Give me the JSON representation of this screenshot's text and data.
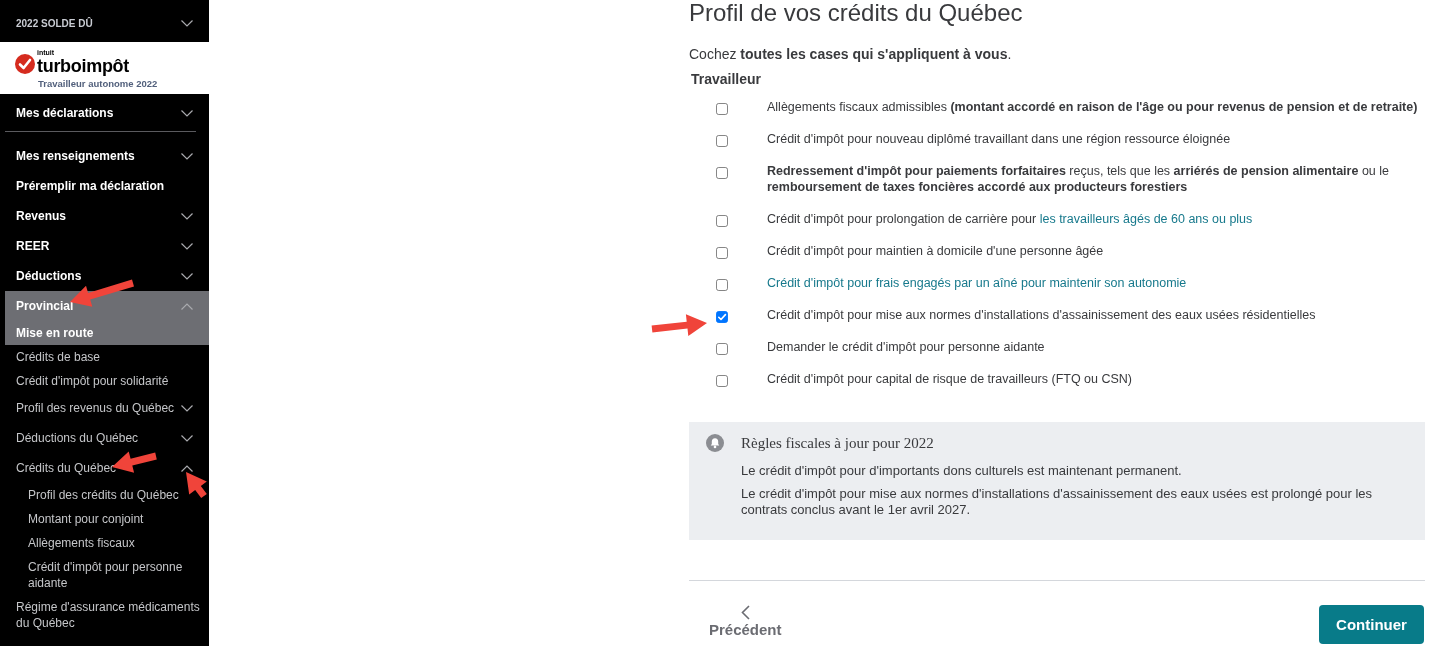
{
  "sidebar": {
    "balance": {
      "label": "2022 SOLDE DÛ",
      "expanded": false
    },
    "logo": {
      "brand": "intuit",
      "product": "turboimpôt",
      "edition": "Travailleur autonome 2022"
    },
    "menu_groups": [
      {
        "items": [
          {
            "label": "Mes déclarations",
            "kind": "group",
            "expanded": false,
            "selected": false
          }
        ]
      },
      {
        "items": [
          {
            "label": "Mes renseignements",
            "kind": "group",
            "expanded": false,
            "selected": false
          },
          {
            "label": "Préremplir ma déclaration",
            "kind": "link",
            "selected": false
          },
          {
            "label": "Revenus",
            "kind": "group",
            "expanded": false,
            "selected": false
          },
          {
            "label": "REER",
            "kind": "group",
            "expanded": false,
            "selected": false
          },
          {
            "label": "Déductions",
            "kind": "group",
            "expanded": false,
            "selected": false
          },
          {
            "label": "Provincial",
            "kind": "group",
            "expanded": true,
            "selected": true,
            "children": [
              {
                "label": "Mise en route",
                "kind": "link",
                "selected": true
              },
              {
                "label": "Crédits de base",
                "kind": "link",
                "selected": false
              },
              {
                "label": "Crédit d'impôt pour solidarité",
                "kind": "link",
                "selected": false
              },
              {
                "label": "Profil des revenus du Québec",
                "kind": "group",
                "expanded": false,
                "selected": false
              },
              {
                "label": "Déductions du Québec",
                "kind": "group",
                "expanded": false,
                "selected": false
              },
              {
                "label": "Crédits du Québec",
                "kind": "group",
                "expanded": true,
                "selected": false,
                "children": [
                  {
                    "label": "Profil des crédits du Québec",
                    "kind": "link",
                    "selected": false
                  },
                  {
                    "label": "Montant pour conjoint",
                    "kind": "link",
                    "selected": false
                  },
                  {
                    "label": "Allègements fiscaux",
                    "kind": "link",
                    "selected": false
                  },
                  {
                    "label": "Crédit d'impôt pour personne aidante",
                    "kind": "link",
                    "selected": false
                  }
                ]
              },
              {
                "label": "Régime d'assurance médicaments du Québec",
                "kind": "link",
                "selected": false
              }
            ]
          }
        ]
      }
    ]
  },
  "main": {
    "title": "Profil de vos crédits du Québec",
    "instruction": "Cochez **toutes les cases qui s'appliquent à vous**.",
    "section_label": "Travailleur",
    "options": [
      {
        "parts": [
          {
            "kind": "text",
            "text": "Allègements fiscaux admissibles **(montant accordé en raison de l'âge ou pour revenus de pension et de retraite)**"
          }
        ],
        "checked": false
      },
      {
        "parts": [
          {
            "kind": "text",
            "text": "Crédit d'impôt pour nouveau diplômé travaillant dans une région ressource éloignée"
          }
        ],
        "checked": false
      },
      {
        "parts": [
          {
            "kind": "text",
            "text": "**Redressement d'impôt pour paiements forfaitaires** reçus, tels que les **arriérés de pension alimentaire** ou le **remboursement de taxes foncières accordé aux producteurs forestiers**"
          }
        ],
        "checked": false
      },
      {
        "parts": [
          {
            "kind": "text",
            "text": "Crédit d'impôt pour prolongation de carrière pour "
          },
          {
            "kind": "link",
            "text": "les travailleurs âgés de 60 ans ou plus"
          }
        ],
        "checked": false
      },
      {
        "parts": [
          {
            "kind": "text",
            "text": "Crédit d'impôt pour maintien à domicile d'une personne âgée"
          }
        ],
        "checked": false
      },
      {
        "parts": [
          {
            "kind": "link",
            "text": "Crédit d'impôt pour frais engagés par un aîné pour maintenir son autonomie"
          }
        ],
        "checked": false
      },
      {
        "parts": [
          {
            "kind": "text",
            "text": "Crédit d'impôt pour mise aux normes d'installations d'assainissement des eaux usées résidentielles"
          }
        ],
        "checked": true
      },
      {
        "parts": [
          {
            "kind": "text",
            "text": "Demander le crédit d'impôt pour personne aidante"
          }
        ],
        "checked": false
      },
      {
        "parts": [
          {
            "kind": "text",
            "text": "Crédit d'impôt pour capital de risque de travailleurs (FTQ ou CSN)"
          }
        ],
        "checked": false
      }
    ],
    "notice": {
      "title": "Règles fiscales à jour pour 2022",
      "paragraphs": [
        "Le crédit d'impôt pour d'importants dons culturels est maintenant permanent.",
        "Le crédit d'impôt pour mise aux normes d'installations d'assainissement des eaux usées est prolongé pour les contrats conclus avant le 1er avril 2027."
      ]
    },
    "back_button": {
      "label": "Précédent"
    },
    "continue_button": {
      "label": "Continuer"
    }
  }
}
